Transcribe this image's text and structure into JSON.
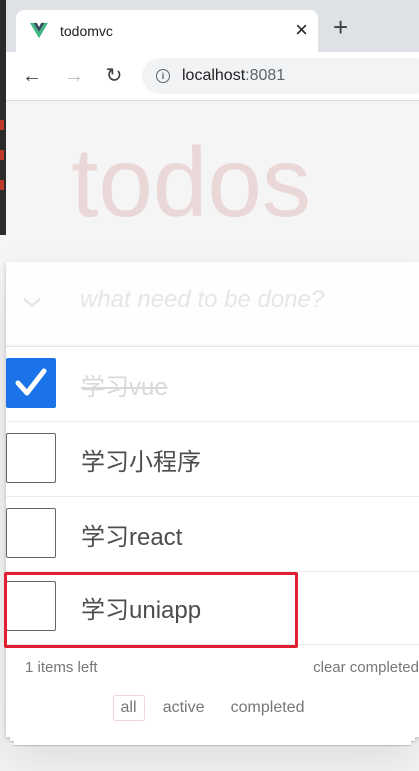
{
  "browser": {
    "tab_title": "todomvc",
    "tab_close": "×",
    "new_tab": "+",
    "url_host": "localhost",
    "url_port": ":8081",
    "back": "←",
    "forward": "→",
    "reload": "↻"
  },
  "app": {
    "title": "todos",
    "new_todo_placeholder": "what need to be done?",
    "todos": [
      {
        "text": "学习vue",
        "completed": true
      },
      {
        "text": "学习小程序",
        "completed": false
      },
      {
        "text": "学习react",
        "completed": false
      },
      {
        "text": "学习uniapp",
        "completed": false
      }
    ],
    "footer": {
      "items_left": "1 items left",
      "clear_completed": "clear completed",
      "filters": [
        {
          "label": "all",
          "selected": true
        },
        {
          "label": "active",
          "selected": false
        },
        {
          "label": "completed",
          "selected": false
        }
      ]
    }
  },
  "colors": {
    "highlight": "#e02030",
    "checkbox_checked": "#1a73e8",
    "title": "rgba(175,47,47,0.15)"
  }
}
